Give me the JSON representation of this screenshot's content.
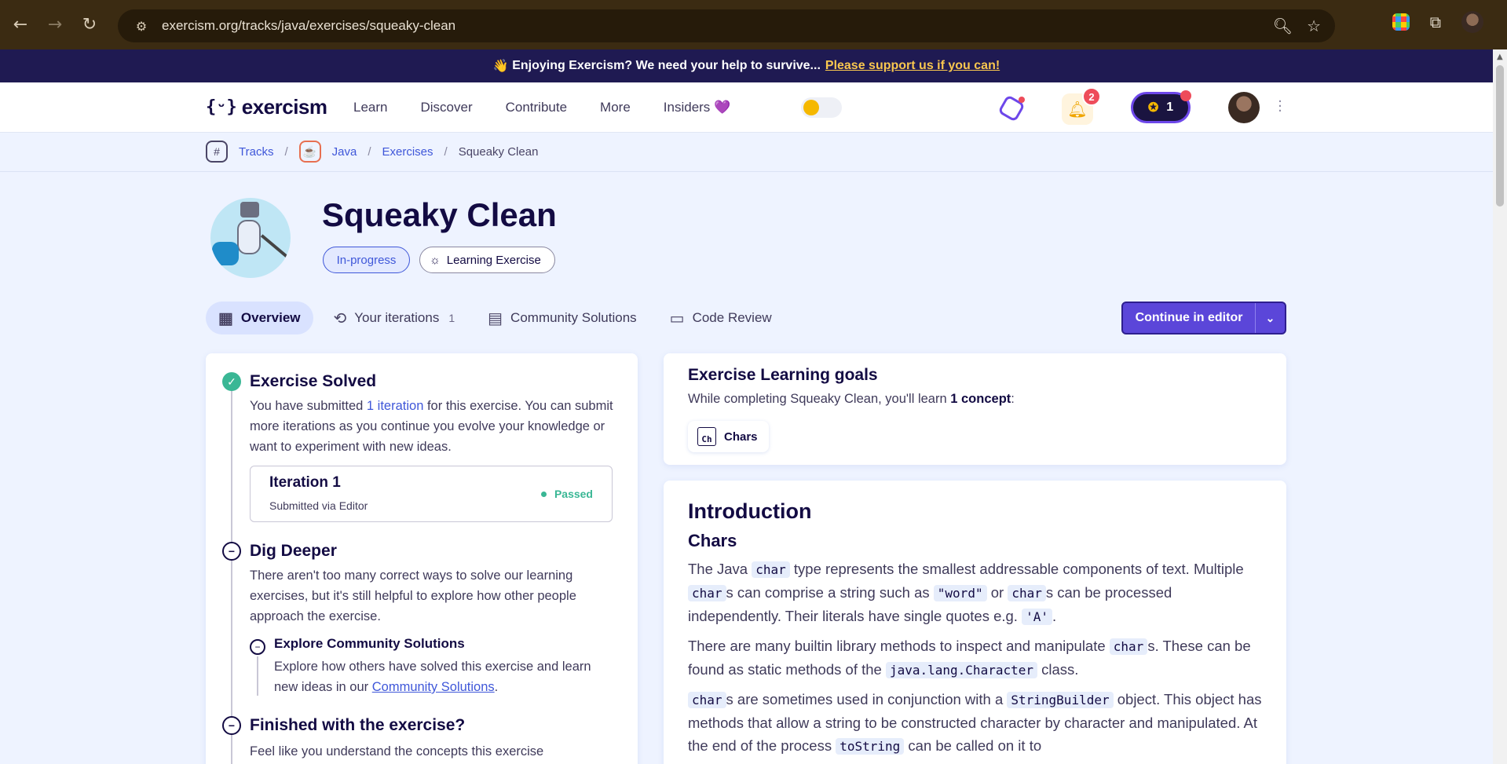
{
  "browser": {
    "url": "exercism.org/tracks/java/exercises/squeaky-clean"
  },
  "banner": {
    "emoji": "👋",
    "text": "Enjoying Exercism? We need your help to survive...",
    "link": "Please support us if you can!"
  },
  "header": {
    "logo_text": "exercism",
    "nav": [
      "Learn",
      "Discover",
      "Contribute",
      "More",
      "Insiders"
    ],
    "insiders_heart": "💜",
    "notifications_count": "2",
    "reputation": "1"
  },
  "breadcrumb": {
    "tracks": "Tracks",
    "track": "Java",
    "exercises": "Exercises",
    "current": "Squeaky Clean",
    "separator": "/"
  },
  "exercise": {
    "title": "Squeaky Clean",
    "status_pill": "In-progress",
    "type_pill": "Learning Exercise"
  },
  "tabs": {
    "overview": "Overview",
    "iterations": "Your iterations",
    "iterations_count": "1",
    "community": "Community Solutions",
    "review": "Code Review"
  },
  "continue_button": "Continue in editor",
  "left": {
    "solved_title": "Exercise Solved",
    "solved_text_1": "You have submitted ",
    "solved_link": "1 iteration",
    "solved_text_2": " for this exercise. You can submit more iterations as you continue you evolve your knowledge or want to experiment with new ideas.",
    "iteration": {
      "title": "Iteration 1",
      "subtitle": "Submitted via Editor",
      "status": "Passed"
    },
    "dig_title": "Dig Deeper",
    "dig_text": "There aren't too many correct ways to solve our learning exercises, but it's still helpful to explore how other people approach the exercise.",
    "explore_title": "Explore Community Solutions",
    "explore_text": "Explore how others have solved this exercise and learn new ideas in our ",
    "explore_link": "Community Solutions",
    "explore_end": ".",
    "finished_title": "Finished with the exercise?",
    "finished_text": "Feel like you understand the concepts this exercise"
  },
  "goals": {
    "title": "Exercise Learning goals",
    "text_1": "While completing Squeaky Clean, you'll learn ",
    "text_bold": "1 concept",
    "text_2": ":",
    "concept_icon": "Ch",
    "concept": "Chars"
  },
  "intro": {
    "title": "Introduction",
    "subtitle": "Chars",
    "p1": [
      "The Java ",
      "char",
      " type represents the smallest addressable components of text. Multiple ",
      "char",
      "s can comprise a string such as ",
      "\"word\"",
      " or ",
      "char",
      "s can be processed independently. Their literals have single quotes e.g. ",
      "'A'",
      "."
    ],
    "p2": [
      "There are many builtin library methods to inspect and manipulate ",
      "char",
      "s. These can be found as static methods of the ",
      "java.lang.Character",
      " class."
    ],
    "p3": [
      "char",
      "s are sometimes used in conjunction with a ",
      "StringBuilder",
      " object. This object has methods that allow a string to be constructed character by character and manipulated. At the end of the process ",
      "toString",
      " can be called on it to"
    ]
  }
}
